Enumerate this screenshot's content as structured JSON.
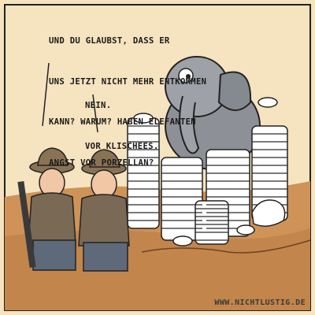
{
  "speech_bubbles": {
    "first": {
      "lines": [
        "UND DU GLAUBST, DASS ER",
        "UNS JETZT NICHT MEHR ENTKOMMEN",
        "KANN? WARUM? HABEN ELEFANTEN",
        "ANGST VOR PORZELLAN?"
      ]
    },
    "second": {
      "lines": [
        "NEIN.",
        "VOR KLISCHEES."
      ]
    }
  },
  "watermark": "WWW.NICHTLUSTIG.DE",
  "colors": {
    "background_wall": "#f6e3bf",
    "ground": "#c98a4c",
    "elephant": "#8d9096",
    "plates": "#ffffff",
    "plate_lines": "#2b2b2b",
    "hunter_vest": "#7a6a55",
    "hunter_pants": "#5e6a7a",
    "hat": "#8a7355"
  }
}
